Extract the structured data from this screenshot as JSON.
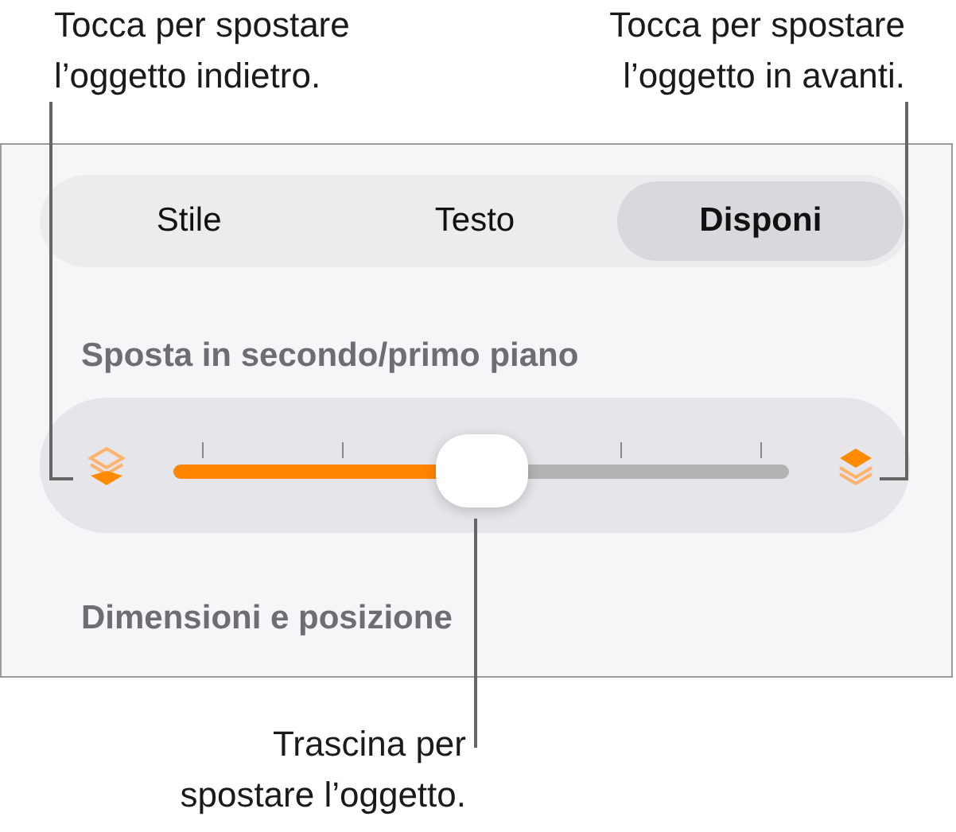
{
  "callouts": [
    {
      "kind": "top-left",
      "text": "Tocca per spostare\nl’oggetto indietro."
    },
    {
      "kind": "top-right",
      "text": "Tocca per spostare\nl’oggetto in avanti."
    },
    {
      "kind": "bottom",
      "text": "Trascina per\nspostare l’oggetto."
    }
  ],
  "tabs": [
    {
      "label": "Stile",
      "selected": false
    },
    {
      "label": "Testo",
      "selected": false
    },
    {
      "label": "Disponi",
      "selected": true
    }
  ],
  "sections": [
    {
      "title": "Sposta in secondo/primo piano"
    },
    {
      "title": "Dimensioni e posizione"
    }
  ],
  "slider": {
    "level": 0.5
  }
}
